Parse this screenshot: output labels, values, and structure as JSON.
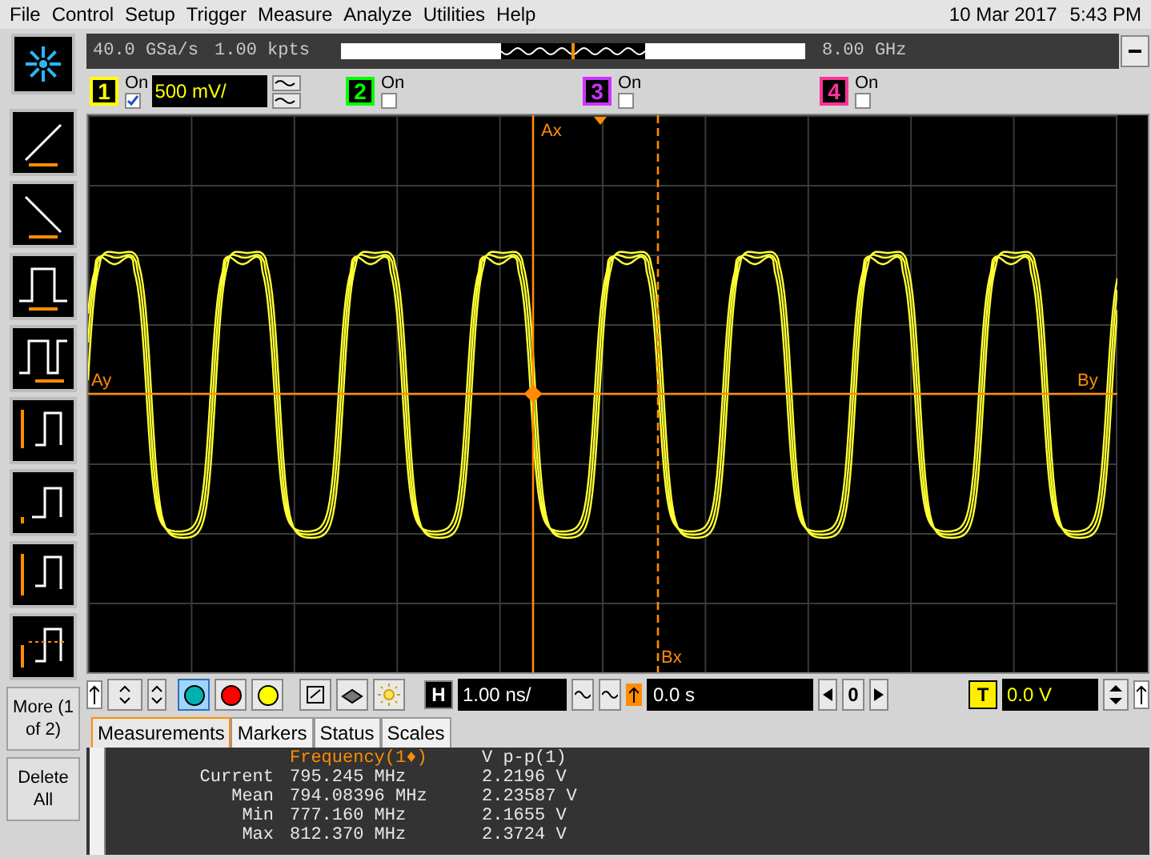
{
  "menu": [
    "File",
    "Control",
    "Setup",
    "Trigger",
    "Measure",
    "Analyze",
    "Utilities",
    "Help"
  ],
  "clock": {
    "date": "10 Mar 2017",
    "time": "5:43 PM"
  },
  "acquisition": {
    "sample_rate": "40.0 GSa/s",
    "memory": "1.00 kpts",
    "bandwidth": "8.00 GHz"
  },
  "channels": [
    {
      "number": "1",
      "label": "On",
      "checked": true,
      "color": "#ffff00",
      "scale": "500 mV/"
    },
    {
      "number": "2",
      "label": "On",
      "checked": false,
      "color": "#00ff00"
    },
    {
      "number": "3",
      "label": "On",
      "checked": false,
      "color": "#cc33ff"
    },
    {
      "number": "4",
      "label": "On",
      "checked": false,
      "color": "#ff3399"
    }
  ],
  "side_buttons": [
    "More (1 of 2)",
    "Delete All"
  ],
  "markers": {
    "ax": "Ax",
    "bx": "Bx",
    "ay": "Ay",
    "by": "By"
  },
  "color_buttons": [
    {
      "color": "#00b0b0",
      "selected": true
    },
    {
      "color": "#ff0000",
      "selected": false
    },
    {
      "color": "#ffff00",
      "selected": false
    }
  ],
  "horizontal": {
    "badge": "H",
    "scale": "1.00 ns/",
    "position": "0.0 s",
    "zoom": "0"
  },
  "trigger": {
    "badge": "T",
    "level": "0.0 V"
  },
  "tabs": [
    {
      "label": "Measurements",
      "selected": true
    },
    {
      "label": "Markers",
      "selected": false
    },
    {
      "label": "Status",
      "selected": false
    },
    {
      "label": "Scales",
      "selected": false
    }
  ],
  "measurements": {
    "headers": [
      "Frequency(1♦)",
      "V p-p(1)"
    ],
    "rows": [
      {
        "label": "Current",
        "values": [
          "795.245 MHz",
          "2.2196 V"
        ]
      },
      {
        "label": "Mean",
        "values": [
          "794.08396 MHz",
          "2.23587 V"
        ]
      },
      {
        "label": "Min",
        "values": [
          "777.160 MHz",
          "2.1655 V"
        ]
      },
      {
        "label": "Max",
        "values": [
          "812.370 MHz",
          "2.3724 V"
        ]
      }
    ]
  }
}
